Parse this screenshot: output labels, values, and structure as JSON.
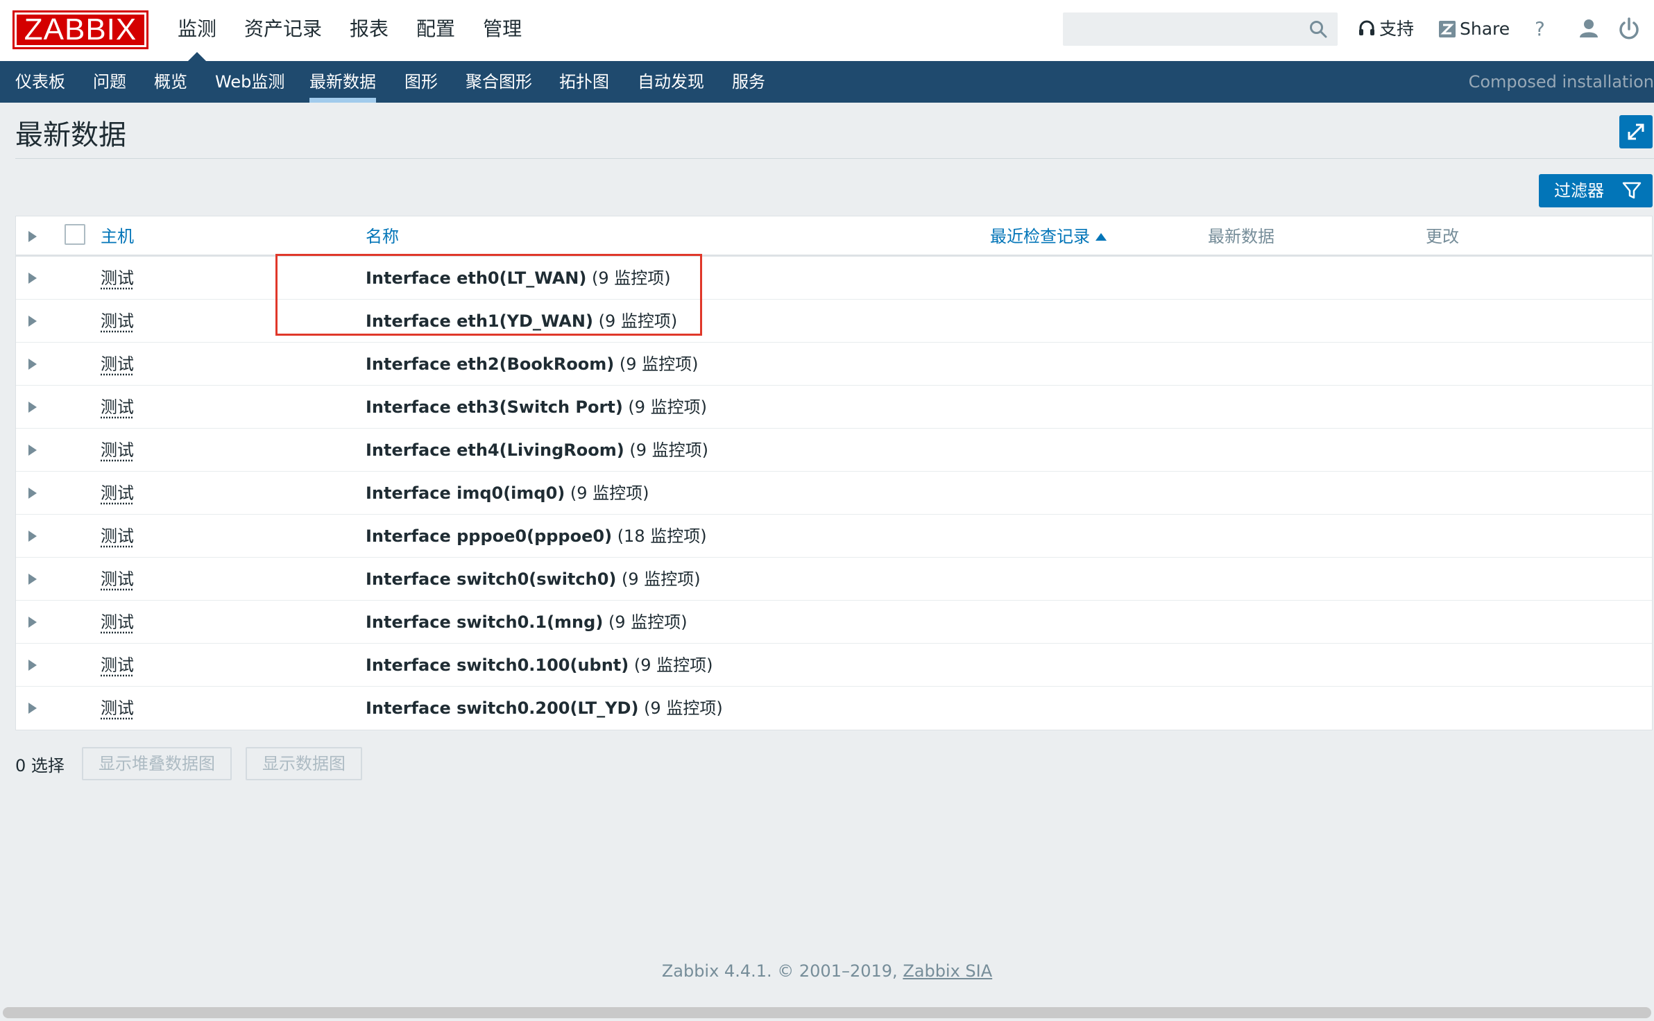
{
  "brand": {
    "logo": "ZABBIX"
  },
  "main_menu": [
    {
      "label": "监测"
    },
    {
      "label": "资产记录"
    },
    {
      "label": "报表"
    },
    {
      "label": "配置"
    },
    {
      "label": "管理"
    }
  ],
  "topbar": {
    "search_placeholder": "",
    "support_label": "支持",
    "share_label": "Share",
    "help_label": "?"
  },
  "sub_menu": [
    {
      "label": "仪表板"
    },
    {
      "label": "问题"
    },
    {
      "label": "概览"
    },
    {
      "label": "Web监测"
    },
    {
      "label": "最新数据"
    },
    {
      "label": "图形"
    },
    {
      "label": "聚合图形"
    },
    {
      "label": "拓扑图"
    },
    {
      "label": "自动发现"
    },
    {
      "label": "服务"
    }
  ],
  "composed_label": "Composed installation",
  "page_title": "最新数据",
  "filter_label": "过滤器",
  "table": {
    "columns": {
      "host": "主机",
      "name": "名称",
      "last_check": "最近检查记录",
      "last_value": "最新数据",
      "change": "更改"
    },
    "rows": [
      {
        "host": "测试",
        "app": "Interface eth0(LT_WAN)",
        "count": "(9 监控项)"
      },
      {
        "host": "测试",
        "app": "Interface eth1(YD_WAN)",
        "count": "(9 监控项)"
      },
      {
        "host": "测试",
        "app": "Interface eth2(BookRoom)",
        "count": "(9 监控项)"
      },
      {
        "host": "测试",
        "app": "Interface eth3(Switch Port)",
        "count": "(9 监控项)"
      },
      {
        "host": "测试",
        "app": "Interface eth4(LivingRoom)",
        "count": "(9 监控项)"
      },
      {
        "host": "测试",
        "app": "Interface imq0(imq0)",
        "count": "(9 监控项)"
      },
      {
        "host": "测试",
        "app": "Interface pppoe0(pppoe0)",
        "count": "(18 监控项)"
      },
      {
        "host": "测试",
        "app": "Interface switch0(switch0)",
        "count": "(9 监控项)"
      },
      {
        "host": "测试",
        "app": "Interface switch0.1(mng)",
        "count": "(9 监控项)"
      },
      {
        "host": "测试",
        "app": "Interface switch0.100(ubnt)",
        "count": "(9 监控项)"
      },
      {
        "host": "测试",
        "app": "Interface switch0.200(LT_YD)",
        "count": "(9 监控项)"
      }
    ]
  },
  "bottom": {
    "selected": "0 选择",
    "stacked_graph_button": "显示堆叠数据图",
    "graph_button": "显示数据图"
  },
  "footer": {
    "text": "Zabbix 4.4.1. © 2001–2019,",
    "link": "Zabbix SIA"
  },
  "colors": {
    "brand_red": "#d40000",
    "nav_blue": "#1f4a6e",
    "action_blue": "#0275b8",
    "highlight_red": "#e0382a"
  }
}
